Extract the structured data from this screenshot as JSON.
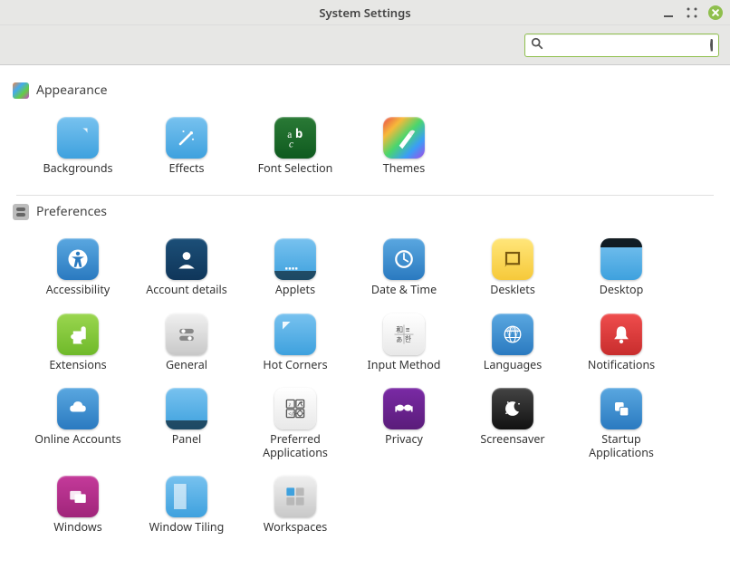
{
  "window": {
    "title": "System Settings"
  },
  "search": {
    "placeholder": "",
    "value": ""
  },
  "sections": {
    "appearance": {
      "title": "Appearance",
      "items": [
        {
          "label": "Backgrounds",
          "icon": "backgrounds-icon"
        },
        {
          "label": "Effects",
          "icon": "effects-icon"
        },
        {
          "label": "Font Selection",
          "icon": "font-selection-icon"
        },
        {
          "label": "Themes",
          "icon": "themes-icon"
        }
      ]
    },
    "preferences": {
      "title": "Preferences",
      "items": [
        {
          "label": "Accessibility",
          "icon": "accessibility-icon"
        },
        {
          "label": "Account details",
          "icon": "account-details-icon"
        },
        {
          "label": "Applets",
          "icon": "applets-icon"
        },
        {
          "label": "Date & Time",
          "icon": "date-time-icon"
        },
        {
          "label": "Desklets",
          "icon": "desklets-icon"
        },
        {
          "label": "Desktop",
          "icon": "desktop-icon"
        },
        {
          "label": "Extensions",
          "icon": "extensions-icon"
        },
        {
          "label": "General",
          "icon": "general-icon"
        },
        {
          "label": "Hot Corners",
          "icon": "hot-corners-icon"
        },
        {
          "label": "Input Method",
          "icon": "input-method-icon"
        },
        {
          "label": "Languages",
          "icon": "languages-icon"
        },
        {
          "label": "Notifications",
          "icon": "notifications-icon"
        },
        {
          "label": "Online Accounts",
          "icon": "online-accounts-icon"
        },
        {
          "label": "Panel",
          "icon": "panel-icon"
        },
        {
          "label": "Preferred Applications",
          "icon": "preferred-apps-icon"
        },
        {
          "label": "Privacy",
          "icon": "privacy-icon"
        },
        {
          "label": "Screensaver",
          "icon": "screensaver-icon"
        },
        {
          "label": "Startup Applications",
          "icon": "startup-apps-icon"
        },
        {
          "label": "Windows",
          "icon": "windows-icon"
        },
        {
          "label": "Window Tiling",
          "icon": "window-tiling-icon"
        },
        {
          "label": "Workspaces",
          "icon": "workspaces-icon"
        }
      ]
    }
  }
}
